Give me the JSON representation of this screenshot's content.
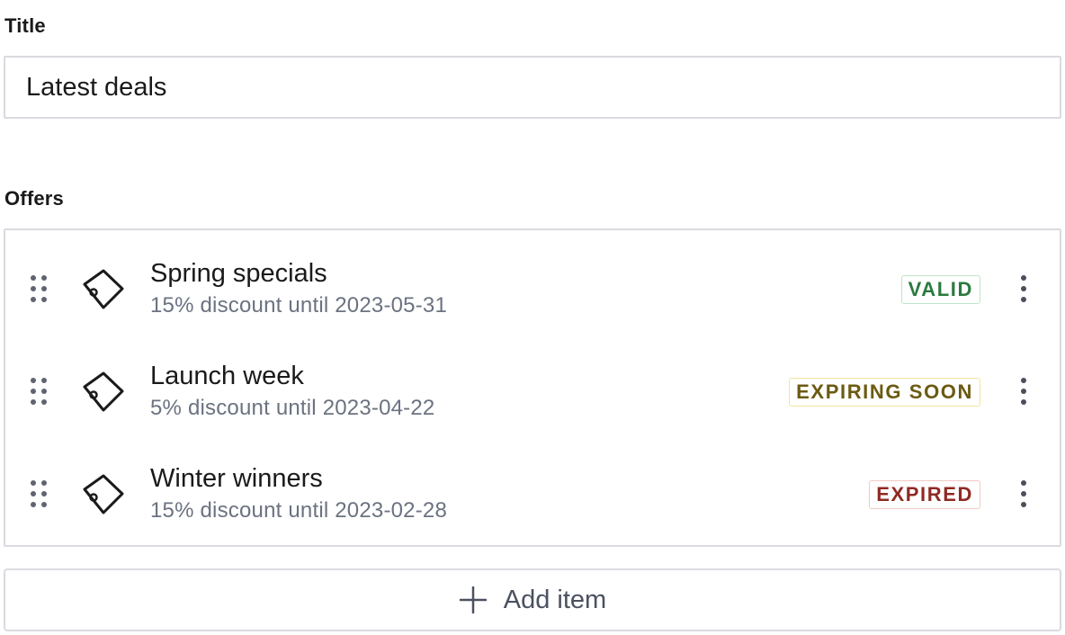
{
  "form": {
    "title_label": "Title",
    "title_value": "Latest deals",
    "offers_label": "Offers"
  },
  "offers": [
    {
      "title": "Spring specials",
      "subtitle": "15% discount until 2023-05-31",
      "status": "VALID",
      "status_text_color": "#2b7a3f",
      "status_border_color": "#bfe5c8",
      "status_bg_color": "#ffffff"
    },
    {
      "title": "Launch week",
      "subtitle": "5% discount until 2023-04-22",
      "status": "EXPIRING SOON",
      "status_text_color": "#6b5a12",
      "status_border_color": "#f3e3a0",
      "status_bg_color": "#ffffff"
    },
    {
      "title": "Winter winners",
      "subtitle": "15% discount until 2023-02-28",
      "status": "EXPIRED",
      "status_text_color": "#8f2a22",
      "status_border_color": "#f2c9c5",
      "status_bg_color": "#ffffff"
    }
  ],
  "icons": {
    "item_icon": "tag-icon",
    "drag": "drag-handle-icon",
    "menu": "more-vertical-icon",
    "add": "plus-icon"
  },
  "add_button": {
    "label": "Add item"
  }
}
